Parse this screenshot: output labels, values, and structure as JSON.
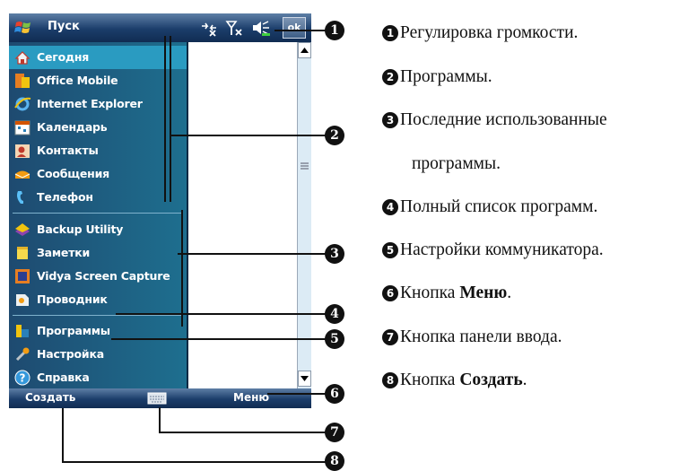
{
  "titlebar": {
    "title": "Пуск",
    "ok_label": "ok"
  },
  "status_icons": [
    "connectivity-icon",
    "signal-icon",
    "volume-icon"
  ],
  "menu": {
    "recent_today": [
      {
        "label": "Сегодня",
        "icon": "today-icon",
        "selected": true
      },
      {
        "label": "Office Mobile",
        "icon": "office-icon"
      },
      {
        "label": "Internet Explorer",
        "icon": "internet-explorer-icon"
      },
      {
        "label": "Календарь",
        "icon": "calendar-icon"
      },
      {
        "label": "Контакты",
        "icon": "contacts-icon"
      },
      {
        "label": "Сообщения",
        "icon": "messages-icon"
      },
      {
        "label": "Телефон",
        "icon": "phone-icon"
      }
    ],
    "recent_programs": [
      {
        "label": "Backup Utility",
        "icon": "backup-icon"
      },
      {
        "label": "Заметки",
        "icon": "notes-icon"
      },
      {
        "label": "Vidya Screen Capture",
        "icon": "screen-capture-icon"
      },
      {
        "label": "Проводник",
        "icon": "explorer-icon"
      }
    ],
    "system": [
      {
        "label": "Программы",
        "icon": "programs-icon"
      },
      {
        "label": "Настройка",
        "icon": "settings-icon"
      },
      {
        "label": "Справка",
        "icon": "help-icon"
      }
    ]
  },
  "bottombar": {
    "create_label": "Создать",
    "menu_label": "Меню"
  },
  "callouts": [
    "❶",
    "❷",
    "❸",
    "❹",
    "❺",
    "❻",
    "❼",
    "❽"
  ],
  "legend": [
    {
      "num": "❶",
      "text": "Регулировка громкости."
    },
    {
      "num": "❷",
      "text": "Программы."
    },
    {
      "num": "❸",
      "text": "Последние использованные"
    },
    {
      "num": "",
      "text": "программы."
    },
    {
      "num": "❹",
      "text": "Полный список программ."
    },
    {
      "num": "❺",
      "text": "Настройки коммуникатора."
    },
    {
      "num": "❻",
      "text": "Кнопка ",
      "bold": "Меню",
      "suffix": "."
    },
    {
      "num": "❼",
      "text": "Кнопка панели ввода."
    },
    {
      "num": "❽",
      "text": "Кнопка ",
      "bold": "Создать",
      "suffix": "."
    }
  ],
  "colors": {
    "menu_bg": "#1e5a80",
    "selected": "#2a9bc1",
    "bar": "#1b3d6a"
  }
}
